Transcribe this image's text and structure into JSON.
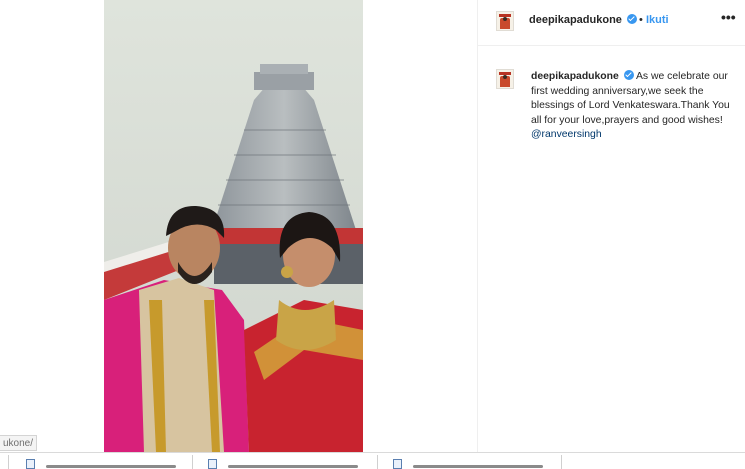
{
  "post": {
    "username": "deepikapadukone",
    "follow_label": "Ikuti",
    "dot": "•",
    "more_label": "•••",
    "caption_text": "As we celebrate our first wedding anniversary,we seek the blessings of Lord Venkateswara.Thank You all for your love,prayers and good wishes!",
    "mention": "@ranveersingh"
  },
  "status_bar": {
    "url_fragment": "ukone/"
  },
  "icons": {
    "verified": "verified-badge-icon",
    "more": "more-options-icon",
    "download": "file-icon"
  },
  "colors": {
    "link_blue": "#3897f0",
    "mention": "#00376b",
    "text": "#262626",
    "border": "#efefef"
  }
}
